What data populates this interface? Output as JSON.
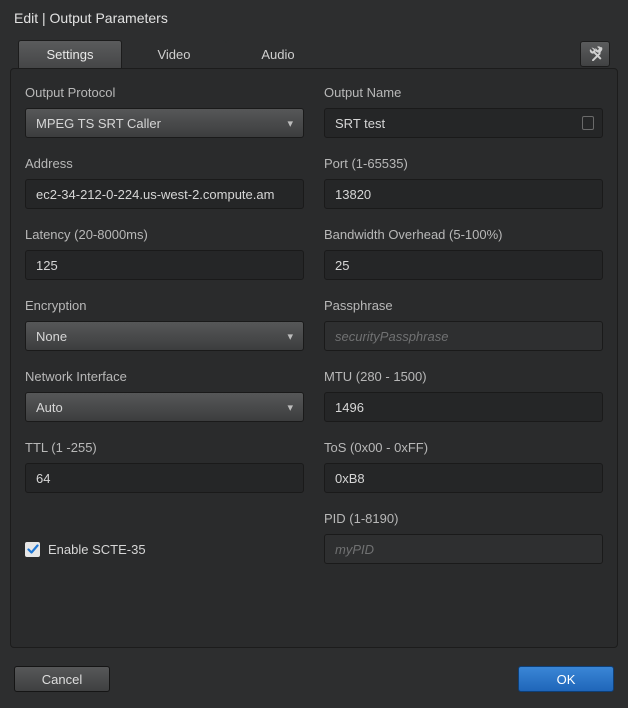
{
  "title": "Edit | Output Parameters",
  "tabs": {
    "settings": "Settings",
    "video": "Video",
    "audio": "Audio"
  },
  "fields": {
    "outputProtocol": {
      "label": "Output Protocol",
      "value": "MPEG TS SRT Caller"
    },
    "outputName": {
      "label": "Output Name",
      "value": "SRT test"
    },
    "address": {
      "label": "Address",
      "value": "ec2-34-212-0-224.us-west-2.compute.am"
    },
    "port": {
      "label": "Port (1-65535)",
      "value": "13820"
    },
    "latency": {
      "label": "Latency (20-8000ms)",
      "value": "125"
    },
    "bandwidth": {
      "label": "Bandwidth Overhead (5-100%)",
      "value": "25"
    },
    "encryption": {
      "label": "Encryption",
      "value": "None"
    },
    "passphrase": {
      "label": "Passphrase",
      "placeholder": "securityPassphrase"
    },
    "networkIf": {
      "label": "Network Interface",
      "value": "Auto"
    },
    "mtu": {
      "label": "MTU (280 - 1500)",
      "value": "1496"
    },
    "ttl": {
      "label": "TTL (1 -255)",
      "value": "64"
    },
    "tos": {
      "label": "ToS (0x00 - 0xFF)",
      "value": "0xB8"
    },
    "pid": {
      "label": "PID (1-8190)",
      "placeholder": "myPID"
    },
    "scte35": {
      "label": "Enable SCTE-35",
      "checked": true
    }
  },
  "buttons": {
    "cancel": "Cancel",
    "ok": "OK"
  }
}
